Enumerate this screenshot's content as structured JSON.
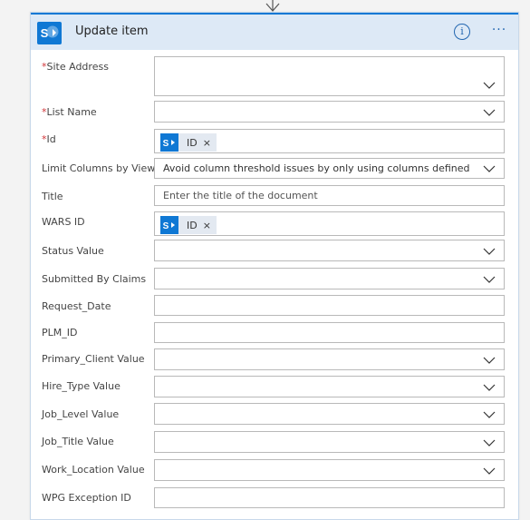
{
  "card": {
    "title": "Update item",
    "info_glyph": "i",
    "more_glyph": "···",
    "icon": "sharepoint-logo",
    "accent_color": "#0f78d4"
  },
  "labels": {
    "site_address": "Site Address",
    "list_name": "List Name",
    "id": "Id",
    "limit_columns": "Limit Columns by View",
    "title": "Title",
    "wars_id": "WARS ID",
    "status_value": "Status Value",
    "submitted_by": "Submitted By Claims",
    "request_date": "Request_Date",
    "plm_id": "PLM_ID",
    "primary_client": "Primary_Client Value",
    "hire_type": "Hire_Type Value",
    "job_level": "Job_Level Value",
    "job_title": "Job_Title Value",
    "work_location": "Work_Location Value",
    "wpg_exception": "WPG Exception ID"
  },
  "required_mark": "*",
  "values": {
    "id_token": "ID",
    "wars_token": "ID",
    "token_remove": "×",
    "limit_columns": "Avoid column threshold issues by only using columns defined in a view",
    "title_placeholder": "Enter the title of the document"
  }
}
